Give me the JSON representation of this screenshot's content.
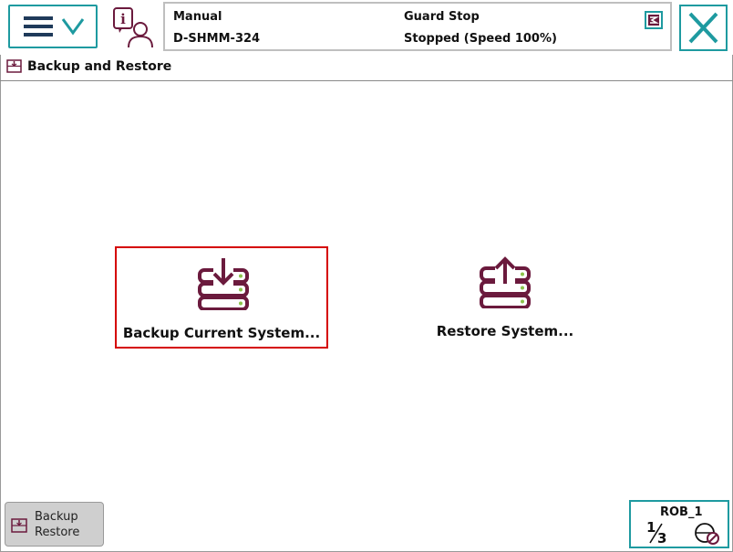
{
  "status": {
    "mode": "Manual",
    "system_name": "D-SHMM-324",
    "safety_state": "Guard Stop",
    "run_state": "Stopped (Speed 100%)"
  },
  "window": {
    "title": "Backup and Restore"
  },
  "main": {
    "backup_label": "Backup Current System...",
    "restore_label": "Restore System..."
  },
  "taskbar": {
    "app_line1": "Backup",
    "app_line2": "Restore"
  },
  "robot": {
    "name": "ROB_1",
    "fraction_num": "1",
    "fraction_den": "3"
  },
  "colors": {
    "accent": "#1e9aa0",
    "icon": "#6b1a3d",
    "selection": "#d50000"
  },
  "icons": {
    "menu": "hamburger-chevron-icon",
    "info": "event-log-info-icon",
    "close": "close-icon",
    "backup": "server-download-icon",
    "restore": "server-upload-icon"
  }
}
